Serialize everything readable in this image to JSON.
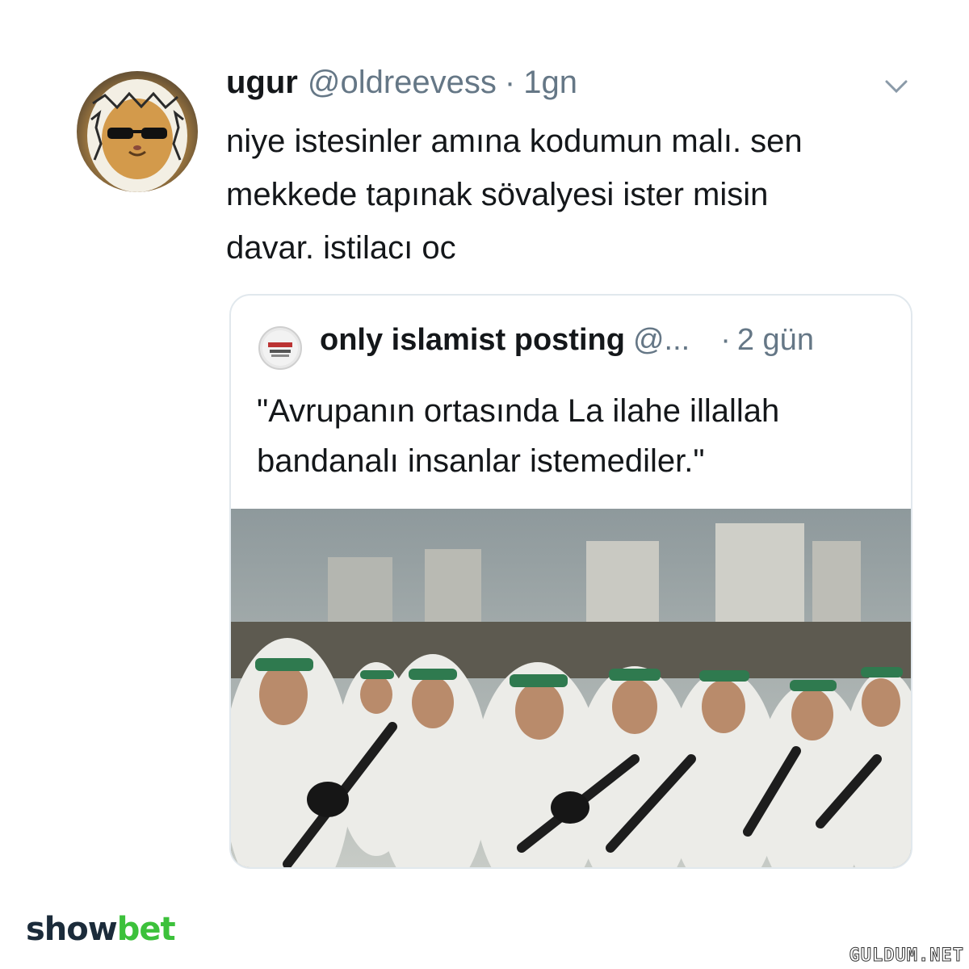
{
  "tweet": {
    "username": "ugur",
    "handle": "@oldreevess",
    "separator": "·",
    "time": "1gn",
    "text": "niye istesinler amına kodumun malı. sen\nmekkede tapınak sövalyesi ister misin\ndavar. istilacı oc",
    "avatar_icon": "cat-with-sunglasses-avatar",
    "menu_icon": "chevron-down-icon"
  },
  "quote": {
    "name": "only islamist posting",
    "handle": "@...",
    "separator": "·",
    "time": "2 gün",
    "text": "\"Avrupanın ortasında La ilahe illallah\nbandanalı insanlar istemediler.\"",
    "photo_alt_icon": "soldiers-photo"
  },
  "branding": {
    "part1": "show",
    "part2": "bet",
    "watermark": "GULDUM.NET"
  },
  "colors": {
    "text": "#14171a",
    "muted": "#657786",
    "border": "#e1e8ed",
    "brand_dark": "#1b2b3a",
    "brand_green": "#3cc13b"
  }
}
